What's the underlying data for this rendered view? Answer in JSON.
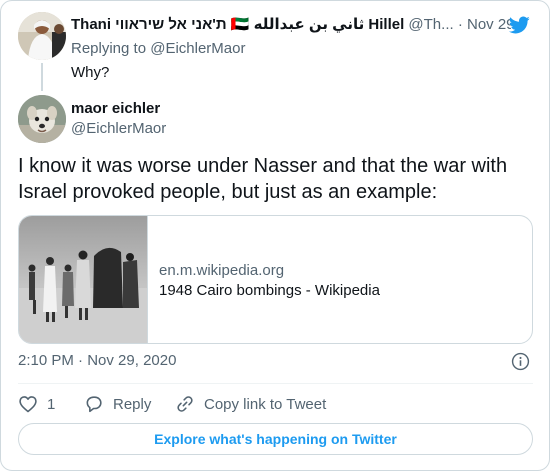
{
  "parent_tweet": {
    "display_name": "Thani ת'אני אל שיראווי 🇦🇪 ثاني بن عبدالله Hillel",
    "handle": "@Th...",
    "separator": "·",
    "date": "Nov 29, 2020",
    "replying_prefix": "Replying to",
    "replying_mention": "@EichlerMaor",
    "text": "Why?",
    "avatar_icon": "person-in-white-robe-avatar"
  },
  "tweet": {
    "display_name": "maor eichler",
    "handle": "@EichlerMaor",
    "text": "I know it was worse under Nasser and that the war with Israel provoked people, but just as an example:",
    "avatar_icon": "dog-avatar"
  },
  "link_card": {
    "domain": "en.m.wikipedia.org",
    "title": "1948 Cairo bombings - Wikipedia",
    "thumbnail_icon": "black-and-white-refugee-photo"
  },
  "meta": {
    "time": "2:10 PM",
    "separator": "·",
    "date": "Nov 29, 2020"
  },
  "actions": {
    "like_count": "1",
    "reply_label": "Reply",
    "copy_label": "Copy link to Tweet"
  },
  "explore_label": "Explore what's happening on Twitter",
  "colors": {
    "brand_blue": "#1d9bf0",
    "text_primary": "#0f1419",
    "text_secondary": "#536471",
    "border": "#cfd9de"
  }
}
